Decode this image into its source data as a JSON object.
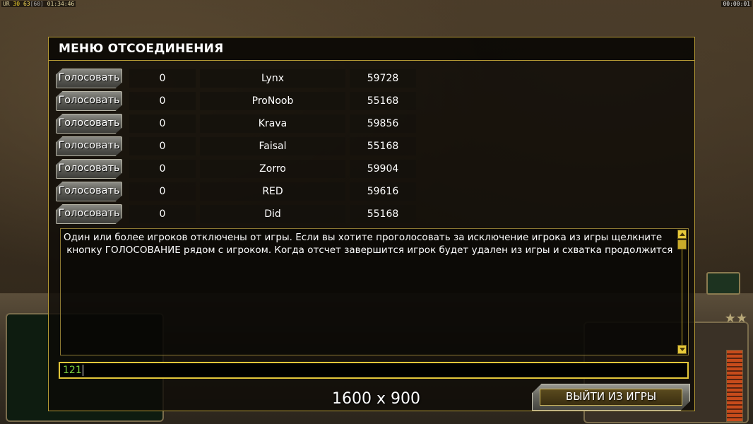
{
  "hud": {
    "fps_label": "UR",
    "fps_a": "30",
    "fps_b": "63",
    "fps_c": "[60]",
    "game_time": "01:34:46",
    "timer_right": "00:00:01"
  },
  "dialog": {
    "title": "МЕНЮ ОТСОЕДИНЕНИЯ",
    "vote_label": "Голосовать",
    "players": [
      {
        "votes": "0",
        "name": "Lynx",
        "id": "59728"
      },
      {
        "votes": "0",
        "name": "ProNoob",
        "id": "55168"
      },
      {
        "votes": "0",
        "name": "Krava",
        "id": "59856"
      },
      {
        "votes": "0",
        "name": "Faisal",
        "id": "55168"
      },
      {
        "votes": "0",
        "name": "Zorro",
        "id": "59904"
      },
      {
        "votes": "0",
        "name": "RED",
        "id": "59616"
      },
      {
        "votes": "0",
        "name": "Did",
        "id": "55168"
      }
    ],
    "message_line1": "Один или более игроков отключены от игры. Если вы хотите проголосовать за исключение игрока из игры щелкните",
    "message_line2": " кнопку ГОЛОСОВАНИЕ рядом с игроком. Когда отсчет завершится игрок будет удален из игры и схватка продолжится",
    "chat_value": "121",
    "quit_label": "ВЫЙТИ ИЗ ИГРЫ"
  },
  "overlay": {
    "resolution": "1600 x 900"
  },
  "colors": {
    "dialog_border": "#b59a35",
    "chat_text": "#7ccf3f",
    "scrollbar": "#e7c93a"
  }
}
